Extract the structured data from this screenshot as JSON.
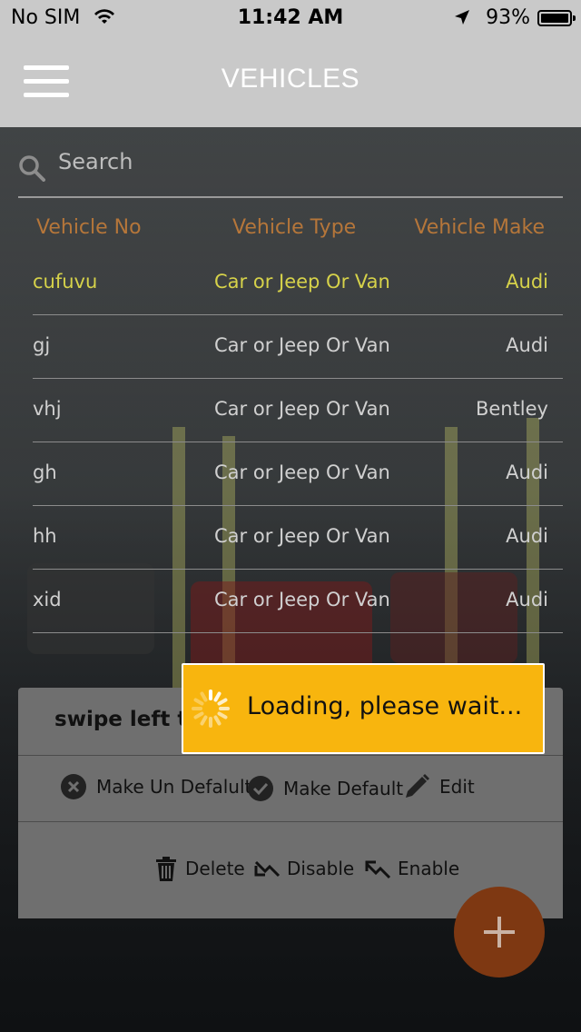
{
  "status_bar": {
    "carrier": "No SIM",
    "time": "11:42 AM",
    "battery": "93%"
  },
  "header": {
    "title": "VEHICLES"
  },
  "search": {
    "placeholder": "Search"
  },
  "table": {
    "columns": [
      "Vehicle No",
      "Vehicle Type",
      "Vehicle Make"
    ],
    "rows": [
      {
        "no": "cufuvu",
        "type": "Car or Jeep Or Van",
        "make": "Audi"
      },
      {
        "no": "gj",
        "type": "Car or Jeep Or Van",
        "make": "Audi"
      },
      {
        "no": "vhj",
        "type": "Car or Jeep Or Van",
        "make": "Bentley"
      },
      {
        "no": "gh",
        "type": "Car or Jeep Or Van",
        "make": "Audi"
      },
      {
        "no": "hh",
        "type": "Car or Jeep Or Van",
        "make": "Audi"
      },
      {
        "no": "xid",
        "type": "Car or Jeep Or Van",
        "make": "Audi"
      }
    ]
  },
  "action_sheet": {
    "hint": "swipe left to",
    "make_un_default": "Make Un Defalult",
    "make_default": "Make Default",
    "edit": "Edit",
    "delete": "Delete",
    "disable": "Disable",
    "enable": "Enable"
  },
  "loading": {
    "message": "Loading, please wait..."
  },
  "colors": {
    "accent": "#f8b50e",
    "header_bg": "#c9c9c9",
    "column_header": "#b5763a",
    "selected_row": "#d6d24a",
    "fab": "#7e3812"
  },
  "icons": [
    "wifi-icon",
    "location-arrow-icon",
    "battery-icon",
    "menu-icon",
    "search-icon",
    "close-circle-icon",
    "check-circle-icon",
    "pencil-icon",
    "trash-icon",
    "trend-down-icon",
    "trend-up-icon",
    "spinner-icon",
    "plus-icon"
  ]
}
